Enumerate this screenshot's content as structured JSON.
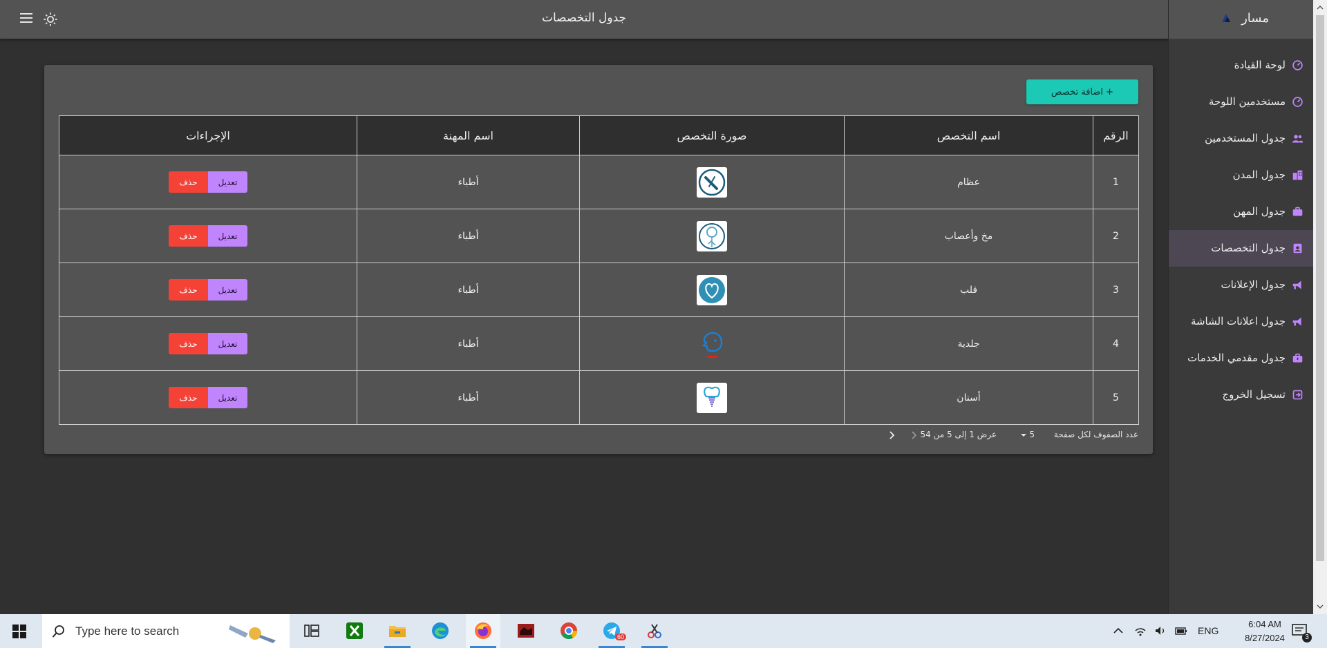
{
  "header": {
    "title": "جدول التخصصات"
  },
  "sidebar": {
    "brand": "مسار",
    "items": [
      {
        "label": "لوحة القيادة",
        "icon": "dashboard-gauge-icon",
        "active": false
      },
      {
        "label": "مستخدمين اللوحة",
        "icon": "dashboard-gauge-icon",
        "active": false
      },
      {
        "label": "جدول المستخدمين",
        "icon": "users-icon",
        "active": false
      },
      {
        "label": "جدول المدن",
        "icon": "city-building-icon",
        "active": false
      },
      {
        "label": "جدول المهن",
        "icon": "briefcase-icon",
        "active": false
      },
      {
        "label": "جدول التخصصات",
        "icon": "id-badge-icon",
        "active": true
      },
      {
        "label": "جدول الإعلانات",
        "icon": "megaphone-icon",
        "active": false
      },
      {
        "label": "جدول اعلانات الشاشة",
        "icon": "megaphone-icon",
        "active": false
      },
      {
        "label": "جدول مقدمي الخدمات",
        "icon": "toolbox-icon",
        "active": false
      },
      {
        "label": "تسجيل الخروج",
        "icon": "logout-icon",
        "active": false
      }
    ],
    "accent": "#c084fc"
  },
  "main": {
    "add_button": "اضافة تخصص +",
    "columns": [
      "الرقم",
      "اسم التخصص",
      "صورة التخصص",
      "اسم المهنة",
      "الإجراءات"
    ],
    "rows": [
      {
        "num": "1",
        "name": "عظام",
        "image": "bone-icon",
        "profession": "أطباء",
        "edit": "تعديل",
        "delete": "حذف"
      },
      {
        "num": "2",
        "name": "مخ وأعصاب",
        "image": "brain-nerves-icon",
        "profession": "أطباء",
        "edit": "تعديل",
        "delete": "حذف"
      },
      {
        "num": "3",
        "name": "قلب",
        "image": "heart-icon",
        "profession": "أطباء",
        "edit": "تعديل",
        "delete": "حذف"
      },
      {
        "num": "4",
        "name": "جلدية",
        "image": "skin-face-icon",
        "profession": "أطباء",
        "edit": "تعديل",
        "delete": "حذف"
      },
      {
        "num": "5",
        "name": "أسنان",
        "image": "tooth-implant-icon",
        "profession": "أطباء",
        "edit": "تعديل",
        "delete": "حذف"
      }
    ],
    "pagination": {
      "rows_per_page_label": "عدد الصفوف لكل صفحة",
      "rows_per_page_value": "5",
      "range_text": "عرض 1 إلى 5 من 54"
    },
    "colors": {
      "add_button": "#1bc9b4",
      "edit_button": "#c084fc",
      "delete_button": "#f44336"
    }
  },
  "taskbar": {
    "search_placeholder": "Type here to search",
    "apps": [
      "task-view-icon",
      "xbox-icon",
      "file-explorer-icon",
      "edge-icon",
      "firefox-icon",
      "app-icon",
      "chrome-icon",
      "telegram-icon",
      "snipping-tool-icon"
    ],
    "telegram_badge": "60",
    "language": "ENG",
    "time": "6:04 AM",
    "date": "8/27/2024",
    "notification_count": "3"
  }
}
